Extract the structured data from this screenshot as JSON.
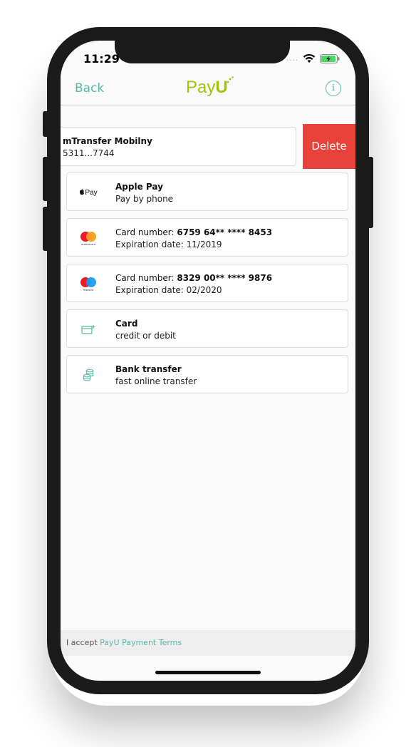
{
  "status": {
    "time": "11:29"
  },
  "nav": {
    "back_label": "Back",
    "logo_text": "Pay",
    "logo_bold": "U",
    "info_glyph": "i"
  },
  "swiped_item": {
    "title": "mTransfer Mobilny",
    "subtitle": "5311...7744",
    "delete_label": "Delete"
  },
  "methods": [
    {
      "icon": "apple-pay-icon",
      "title": "Apple Pay",
      "subtitle": "Pay by phone",
      "icon_text": "Pay"
    },
    {
      "icon": "mastercard-icon",
      "prefix": "Card number: ",
      "number": "6759 64** **** 8453",
      "subtitle": "Expiration date: 11/2019",
      "brand_caption": "mastercard"
    },
    {
      "icon": "maestro-icon",
      "prefix": "Card number: ",
      "number": "8329 00** **** 9876",
      "subtitle": "Expiration date: 02/2020",
      "brand_caption": "maestro"
    },
    {
      "icon": "add-card-icon",
      "title": "Card",
      "subtitle": "credit or debit"
    },
    {
      "icon": "bank-transfer-icon",
      "title": "Bank transfer",
      "subtitle": "fast online transfer"
    }
  ],
  "footer": {
    "prefix": "I accept ",
    "link": "PayU Payment Terms"
  },
  "colors": {
    "accent": "#5ab9a4",
    "brand": "#a6c307",
    "delete": "#e8423a"
  }
}
